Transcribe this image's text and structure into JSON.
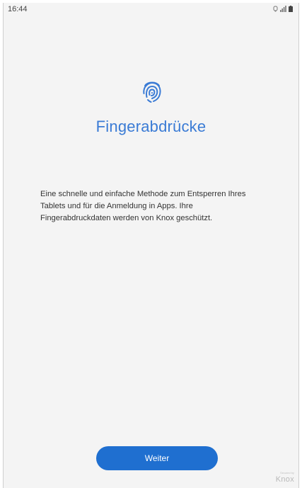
{
  "status_bar": {
    "time": "16:44",
    "icons": [
      "alarm-icon",
      "signal-icon",
      "battery-icon"
    ]
  },
  "main": {
    "icon": "fingerprint-icon",
    "title": "Fingerabdrücke",
    "description": "Eine schnelle und einfache Methode zum Entsperren Ihres Tablets und für die Anmeldung in Apps. Ihre Fingerabdruckdaten werden von Knox geschützt."
  },
  "footer": {
    "next_label": "Weiter",
    "knox_small": "Secured by",
    "knox_text": "Knox"
  },
  "colors": {
    "accent": "#3a7bd5",
    "button": "#1f6fd0",
    "background": "#f4f4f4"
  }
}
